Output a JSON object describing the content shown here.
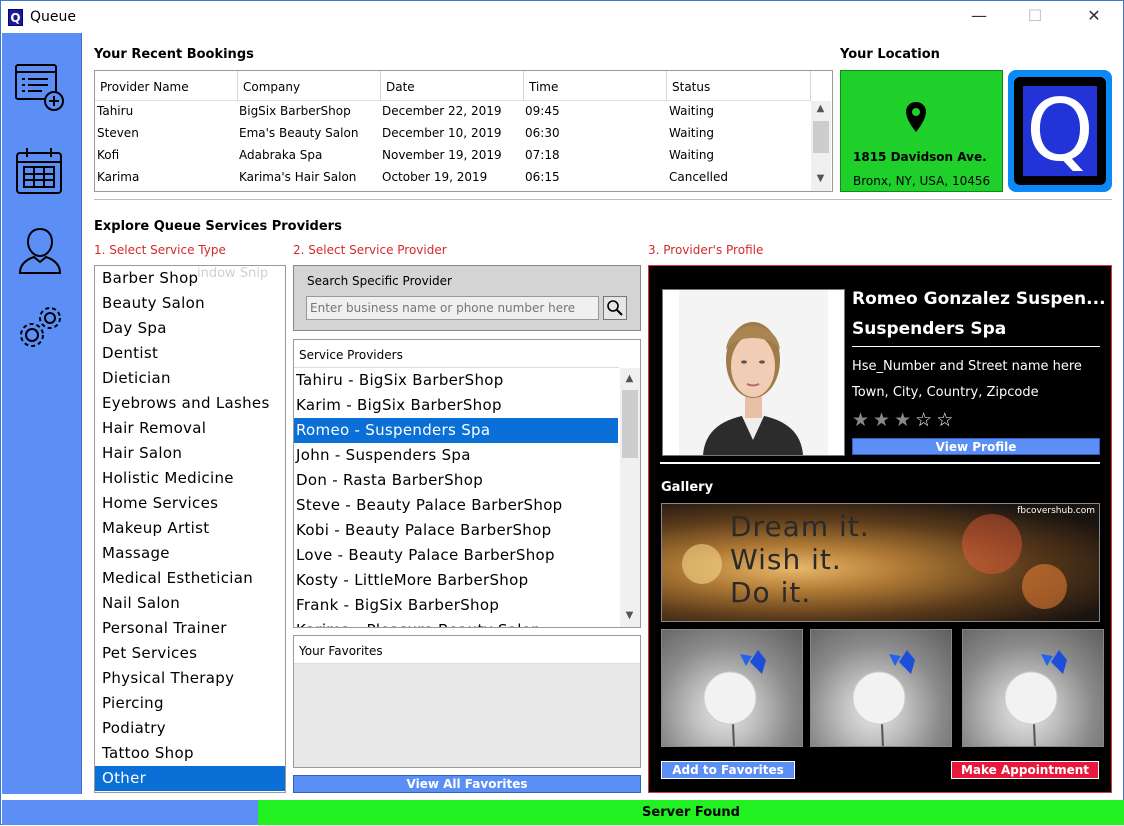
{
  "window": {
    "title": "Queue",
    "app_icon": "Q",
    "minimize": "—",
    "maximize": "☐",
    "close": "✕"
  },
  "sidebar": {
    "icons": [
      "add-booking-icon",
      "calendar-icon",
      "user-icon",
      "settings-icon"
    ]
  },
  "bookings": {
    "title": "Your Recent Bookings",
    "columns": [
      "Provider Name",
      "Company",
      "Date",
      "Time",
      "Status"
    ],
    "rows": [
      [
        "Tahiru",
        "BigSix BarberShop",
        "December 22, 2019",
        "09:45",
        "Waiting"
      ],
      [
        "Steven",
        "Ema's Beauty Salon",
        "December 10, 2019",
        "06:30",
        "Waiting"
      ],
      [
        "Kofi",
        "Adabraka Spa",
        "November 19, 2019",
        "07:18",
        "Waiting"
      ],
      [
        "Karima",
        "Karima's Hair Salon",
        "October 19, 2019",
        "06:15",
        "Cancelled"
      ]
    ]
  },
  "location": {
    "title": "Your Location",
    "line1": "1815 Davidson Ave.",
    "line2": "Bronx, NY, USA, 10456",
    "color": "#1fcf2a"
  },
  "logo": {
    "letter": "Q"
  },
  "explore": {
    "title": "Explore Queue Services Providers",
    "step1": "1. Select Service Type",
    "step2": "2. Select Service Provider",
    "step3": "3. Provider's Profile"
  },
  "service_types": {
    "items": [
      "Barber Shop",
      "Beauty Salon",
      "Day Spa",
      "Dentist",
      "Dietician",
      "Eyebrows and Lashes",
      "Hair Removal",
      "Hair Salon",
      "Holistic Medicine",
      "Home Services",
      "Makeup Artist",
      "Massage",
      "Medical Esthetician",
      "Nail Salon",
      "Personal Trainer",
      "Pet Services",
      "Physical Therapy",
      "Piercing",
      "Podiatry",
      "Tattoo Shop",
      "Other"
    ],
    "selected": "Other",
    "ghost_text": "indow Snip"
  },
  "search": {
    "label": "Search Specific Provider",
    "placeholder": "Enter business name or phone number here"
  },
  "providers": {
    "header": "Service Providers",
    "items": [
      "Tahiru - BigSix BarberShop",
      "Karim - BigSix BarberShop",
      "Romeo - Suspenders Spa",
      "John - Suspenders Spa",
      "Don - Rasta BarberShop",
      "Steve - Beauty Palace BarberShop",
      "Kobi - Beauty Palace BarberShop",
      "Love - Beauty Palace BarberShop",
      "Kosty - LittleMore BarberShop",
      "Frank - BigSix BarberShop",
      "Karima - Pleasure Beauty Salon"
    ],
    "selected": "Romeo - Suspenders Spa"
  },
  "favorites": {
    "header": "Your Favorites",
    "button": "View All Favorites"
  },
  "profile": {
    "name": "Romeo Gonzalez Suspen...",
    "company": "Suspenders Spa",
    "address1": "Hse_Number and Street name here",
    "address2": "Town, City, Country, Zipcode",
    "rating": 3,
    "rating_max": 5,
    "view_button": "View Profile",
    "gallery_title": "Gallery",
    "banner_text": [
      "Dream it.",
      "Wish it.",
      "Do it."
    ],
    "banner_credit": "fbcovershub.com",
    "add_fav_button": "Add to Favorites",
    "make_appt_button": "Make Appointment"
  },
  "status": {
    "text": "Server Found",
    "color": "#21f021"
  }
}
